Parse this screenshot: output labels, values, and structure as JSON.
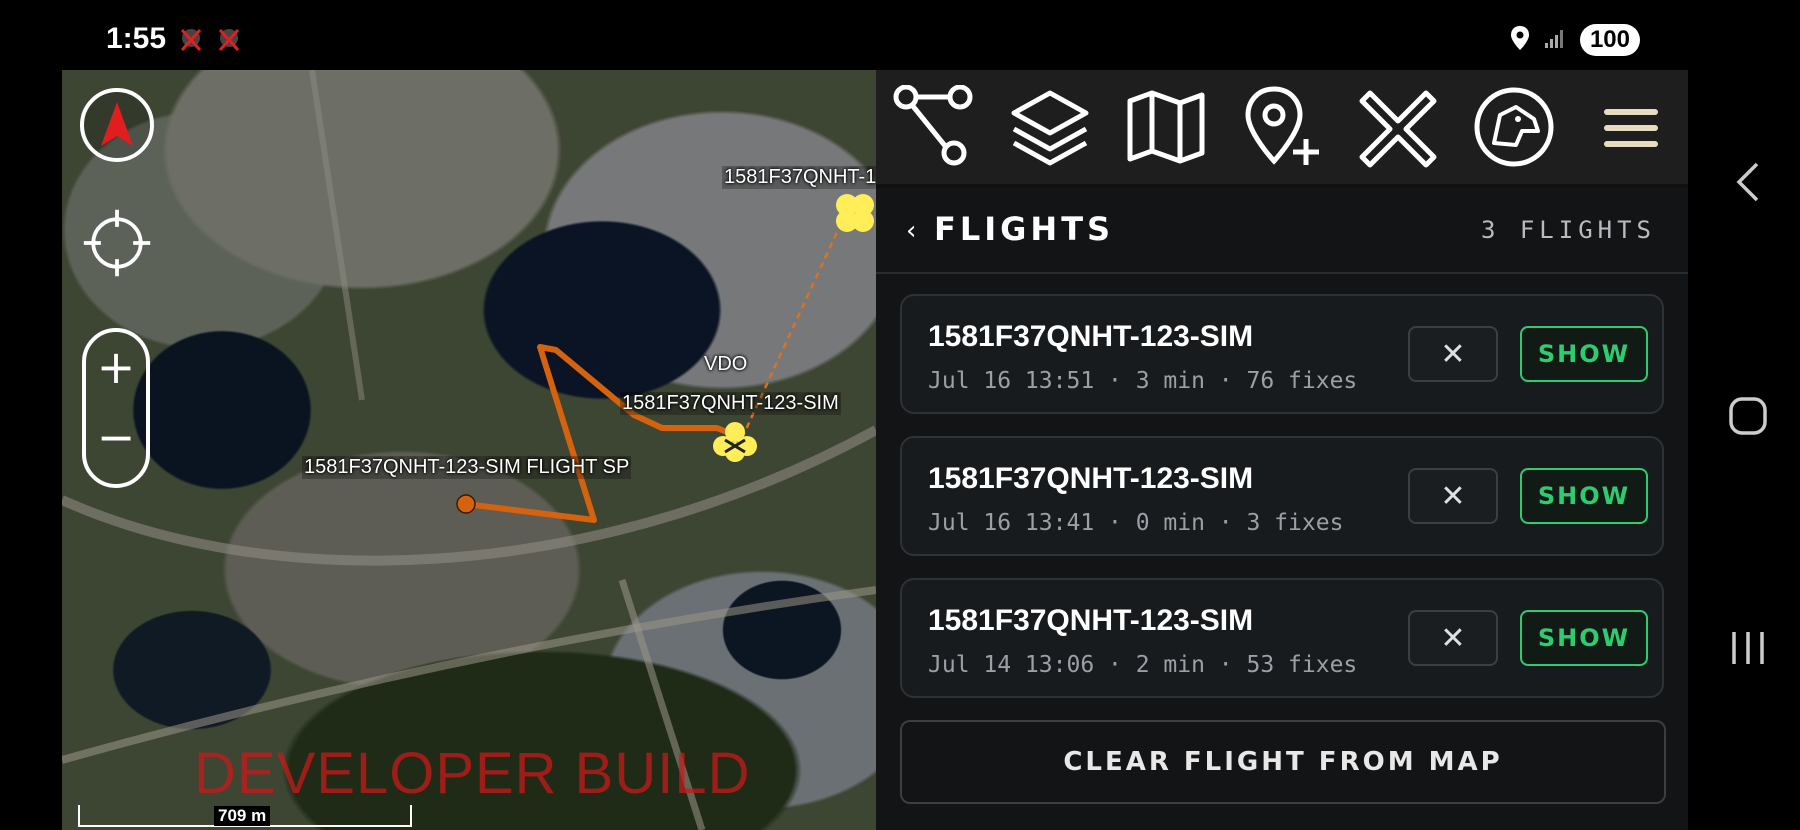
{
  "status_bar": {
    "time": "1:55",
    "battery": "100",
    "notifications": [
      "tak-alert-icon",
      "tak-alert-icon"
    ]
  },
  "map": {
    "labels": {
      "flight_top": "1581F37QNHT-1",
      "vdo": "VDO",
      "flight_mid": "1581F37QNHT-123-SIM",
      "flight_start": "1581F37QNHT-123-SIM FLIGHT SP"
    },
    "watermark": "DEVELOPER BUILD",
    "scale": "709 m",
    "colors": {
      "track": "#d4620f",
      "marker": "#ffee58"
    }
  },
  "toolbar": {
    "items": [
      "route-icon",
      "layers-icon",
      "map-icon",
      "add-pin-icon",
      "close-tools-icon",
      "dog-logo-icon",
      "hamburger-menu-icon"
    ]
  },
  "panel": {
    "back": "‹",
    "title": "FLIGHTS",
    "count": "3 FLIGHTS",
    "flights": [
      {
        "name": "1581F37QNHT-123-SIM",
        "meta": "Jul 16 13:51 · 3 min · 76 fixes",
        "remove": "✕",
        "show": "SHOW"
      },
      {
        "name": "1581F37QNHT-123-SIM",
        "meta": "Jul 16 13:41 · 0 min · 3 fixes",
        "remove": "✕",
        "show": "SHOW"
      },
      {
        "name": "1581F37QNHT-123-SIM",
        "meta": "Jul 14 13:06 · 2 min · 53 fixes",
        "remove": "✕",
        "show": "SHOW"
      }
    ],
    "clear_label": "CLEAR FLIGHT FROM MAP",
    "accent": "#2ecc71"
  },
  "nav": {
    "items": [
      "back-icon",
      "home-icon",
      "recents-icon"
    ]
  }
}
